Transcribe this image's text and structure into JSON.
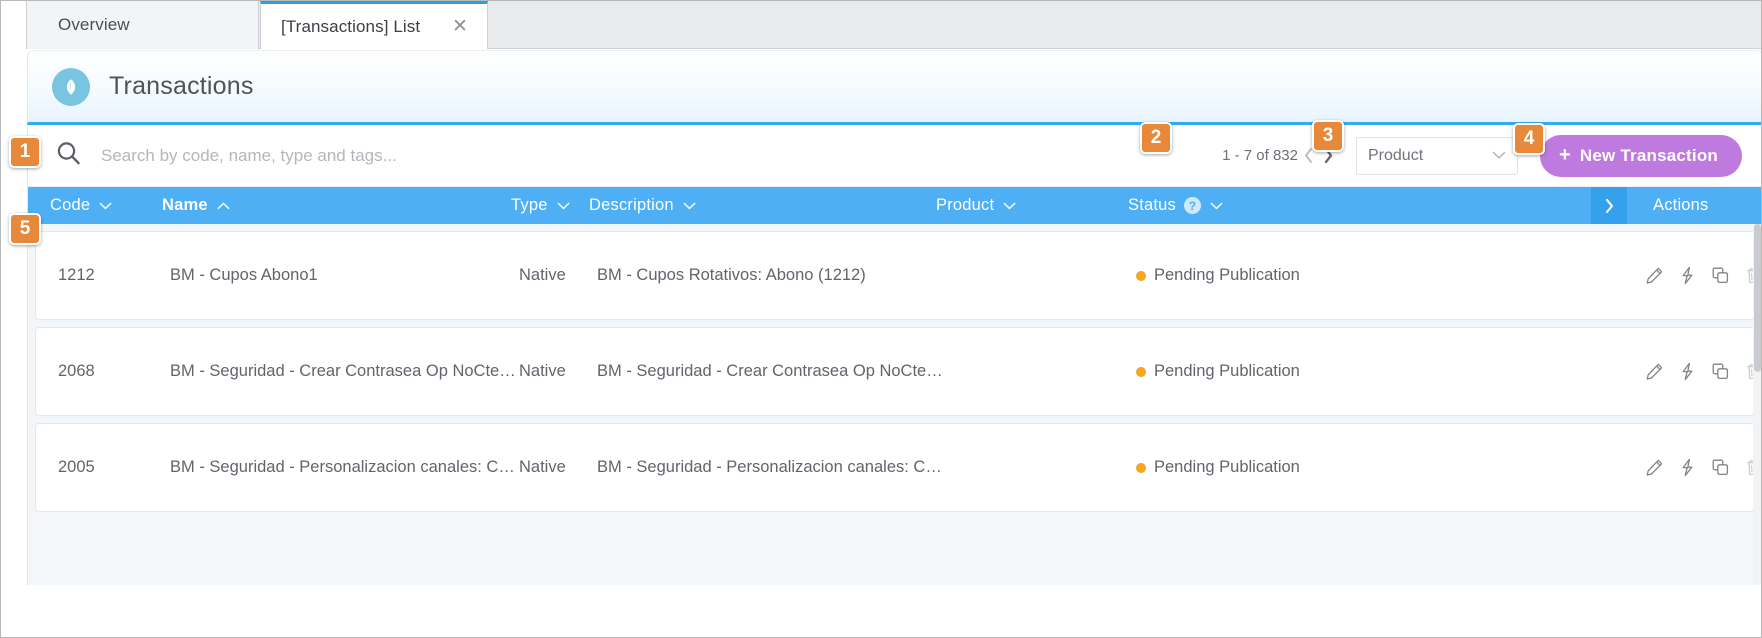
{
  "browser": {
    "tabs": [
      {
        "label": "Overview",
        "active": false,
        "closable": false
      },
      {
        "label": "[Transactions] List",
        "active": true,
        "closable": true,
        "close_icon": "close-icon"
      }
    ]
  },
  "page": {
    "title": "Transactions",
    "logo_icon": "app-leaf-logo-icon",
    "accent_color": "#35aaf0",
    "header_gradient_to": "#e8f4fd"
  },
  "toolbar": {
    "search": {
      "icon": "search-icon",
      "placeholder": "Search by code, name, type and tags...",
      "value": ""
    },
    "pagination": {
      "label": "1 - 7 of 832",
      "prev_icon": "chevron-left-icon",
      "next_icon": "chevron-right-icon",
      "prev_enabled": false,
      "next_enabled": true
    },
    "product_select": {
      "value": "Product",
      "chevron_icon": "chevron-down-icon"
    },
    "new_button": {
      "label": "New Transaction",
      "plus_icon": "plus-icon",
      "color": "#bf7ae0"
    }
  },
  "table": {
    "header_color": "#4eaff4",
    "columns": [
      {
        "key": "code",
        "label": "Code",
        "sorted": false,
        "sort_icon": "chevron-down-icon",
        "help": false
      },
      {
        "key": "name",
        "label": "Name",
        "sorted": true,
        "sort_icon": "chevron-up-icon",
        "help": false
      },
      {
        "key": "type",
        "label": "Type",
        "sorted": false,
        "sort_icon": "chevron-down-icon",
        "help": false
      },
      {
        "key": "description",
        "label": "Description",
        "sorted": false,
        "sort_icon": "chevron-down-icon",
        "help": false
      },
      {
        "key": "product",
        "label": "Product",
        "sorted": false,
        "sort_icon": "chevron-down-icon",
        "help": false
      },
      {
        "key": "status",
        "label": "Status",
        "sorted": false,
        "sort_icon": "chevron-down-icon",
        "help": true,
        "help_icon": "help-question-icon",
        "help_glyph": "?"
      },
      {
        "key": "actions",
        "label": "Actions",
        "sorted": false,
        "help": false
      }
    ],
    "expander_icon": "chevron-right-icon",
    "status_dot_color": "#f5a623",
    "rows": [
      {
        "code": "1212",
        "name": "BM - Cupos Abono1",
        "type": "Native",
        "description": "BM - Cupos Rotativos: Abono (1212)",
        "product": "",
        "status": "Pending Publication",
        "actions": [
          {
            "name": "edit-icon",
            "disabled": false
          },
          {
            "name": "execute-bolt-icon",
            "disabled": false
          },
          {
            "name": "duplicate-icon",
            "disabled": false
          },
          {
            "name": "delete-trash-icon",
            "disabled": true
          }
        ]
      },
      {
        "code": "2068",
        "name": "BM - Seguridad - Crear Contrasea Op NoCte: Genera...",
        "type": "Native",
        "description": "BM - Seguridad - Crear Contrasea Op NoCte: Genera...",
        "product": "",
        "status": "Pending Publication",
        "actions": [
          {
            "name": "edit-icon",
            "disabled": false
          },
          {
            "name": "execute-bolt-icon",
            "disabled": false
          },
          {
            "name": "duplicate-icon",
            "disabled": false
          },
          {
            "name": "delete-trash-icon",
            "disabled": true
          }
        ]
      },
      {
        "code": "2005",
        "name": "BM - Seguridad - Personalizacion canales: Consulta",
        "type": "Native",
        "description": "BM - Seguridad - Personalizacion canales: Consulta (...",
        "product": "",
        "status": "Pending Publication",
        "actions": [
          {
            "name": "edit-icon",
            "disabled": false
          },
          {
            "name": "execute-bolt-icon",
            "disabled": false
          },
          {
            "name": "duplicate-icon",
            "disabled": false
          },
          {
            "name": "delete-trash-icon",
            "disabled": true
          }
        ]
      }
    ]
  },
  "callouts": [
    {
      "number": "1",
      "target": "search-input"
    },
    {
      "number": "2",
      "target": "pagination"
    },
    {
      "number": "3",
      "target": "product-select"
    },
    {
      "number": "4",
      "target": "new-transaction-button"
    },
    {
      "number": "5",
      "target": "table-header"
    }
  ],
  "callout_color": "#e8883a"
}
